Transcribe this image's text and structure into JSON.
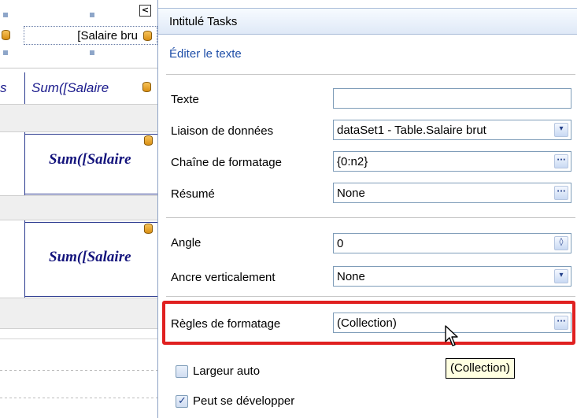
{
  "designer": {
    "field_text": "[Salaire bru",
    "sum_row_prefix": "s",
    "sum_row_text": "Sum([Salaire",
    "sum_cell_1": "Sum([Salaire",
    "sum_cell_2": "Sum([Salaire",
    "collapse_glyph": "<"
  },
  "panel": {
    "title": "Intitulé Tasks",
    "edit_link": "Éditer le texte",
    "properties": [
      {
        "label": "Texte",
        "value": "",
        "button": "none"
      },
      {
        "label": "Liaison de données",
        "value": "dataSet1 - Table.Salaire brut",
        "button": "dropdown"
      },
      {
        "label": "Chaîne de formatage",
        "value": "{0:n2}",
        "button": "ellipsis"
      },
      {
        "label": "Résumé",
        "value": "None",
        "button": "ellipsis"
      },
      {
        "label": "Angle",
        "value": "0",
        "button": "spinner"
      },
      {
        "label": "Ancre verticalement",
        "value": "None",
        "button": "dropdown"
      },
      {
        "label": "Règles de formatage",
        "value": "(Collection)",
        "button": "ellipsis"
      }
    ],
    "checkboxes": [
      {
        "label": "Largeur auto",
        "checked": false
      },
      {
        "label": "Peut se développer",
        "checked": true
      }
    ],
    "tooltip": "(Collection)",
    "button_glyphs": {
      "ellipsis": "···",
      "dropdown": "▾",
      "spinner": "◊"
    }
  },
  "colors": {
    "highlight": "#e02020",
    "link": "#1f4fa8",
    "header_gradient_top": "#f7fbff",
    "header_gradient_bottom": "#dfe9f7"
  }
}
